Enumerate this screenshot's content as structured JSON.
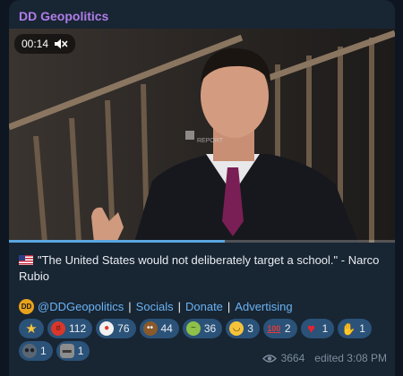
{
  "channel": {
    "name": "DD Geopolitics"
  },
  "video": {
    "time": "00:14",
    "progress": 0.56,
    "watermark": "REPORT"
  },
  "caption": {
    "text": "\"The United States would not deliberately target a school.\" - Narco Rubio"
  },
  "links": {
    "handle": "@DDGeopolitics",
    "sep": "|",
    "socials": "Socials",
    "donate": "Donate",
    "advertising": "Advertising"
  },
  "reactions": [
    {
      "icon": "star-icon",
      "count": ""
    },
    {
      "icon": "angry-face-icon",
      "count": "112"
    },
    {
      "icon": "clown-face-icon",
      "count": "76"
    },
    {
      "icon": "poop-icon",
      "count": "44"
    },
    {
      "icon": "nauseated-face-icon",
      "count": "36"
    },
    {
      "icon": "grinning-face-icon",
      "count": "3"
    },
    {
      "icon": "hundred-points-icon",
      "count": "2"
    },
    {
      "icon": "red-heart-icon",
      "count": "1"
    },
    {
      "icon": "clapping-hands-icon",
      "count": "1"
    },
    {
      "icon": "ghost-face-icon",
      "count": "1"
    },
    {
      "icon": "moai-icon",
      "count": "1"
    }
  ],
  "footer": {
    "views": "3664",
    "edited": "edited 3:08 PM"
  },
  "colors": {
    "accent": "#6ab3f3",
    "channel": "#b07de8",
    "pill": "#2b5278"
  }
}
